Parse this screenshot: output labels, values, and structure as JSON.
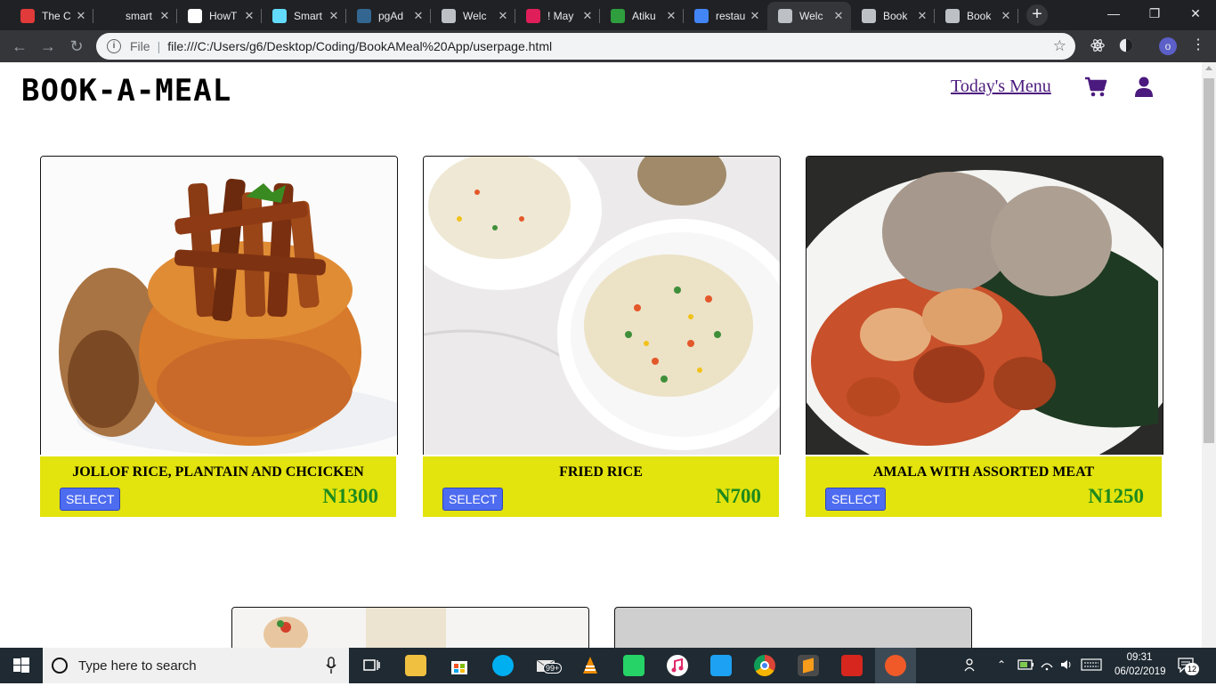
{
  "browser": {
    "tabs": [
      {
        "title": "The C",
        "favicon_color": "#e03a3a"
      },
      {
        "title": "smart",
        "favicon_color": "#202124"
      },
      {
        "title": "HowT",
        "favicon_color": "#ffffff"
      },
      {
        "title": "Smart",
        "favicon_color": "#61dafb"
      },
      {
        "title": "pgAd",
        "favicon_color": "#336791"
      },
      {
        "title": "Welc",
        "favicon_color": "#bdc1c6"
      },
      {
        "title": "! May",
        "favicon_color": "#e01e5a"
      },
      {
        "title": "Atiku",
        "favicon_color": "#2e9e3e"
      },
      {
        "title": "restau",
        "favicon_color": "#4285f4"
      },
      {
        "title": "Welc",
        "favicon_color": "#bdc1c6"
      },
      {
        "title": "Book",
        "favicon_color": "#bdc1c6"
      },
      {
        "title": "Book",
        "favicon_color": "#bdc1c6"
      }
    ],
    "active_tab_index": 9,
    "close_glyph": "✕",
    "new_tab_glyph": "+",
    "address": {
      "scheme_label": "File",
      "url": "file:///C:/Users/g6/Desktop/Coding/BookAMeal%20App/userpage.html"
    },
    "profile_initial": "o"
  },
  "page": {
    "logo": "BOOK-A-MEAL",
    "nav_link": "Today's Menu",
    "accent_color": "#4b1a7e",
    "meals": [
      {
        "name": "JOLLOF RICE, PLANTAIN AND CHCICKEN",
        "price": "N1300",
        "button": "SELECT"
      },
      {
        "name": "FRIED RICE",
        "price": "N700",
        "button": "SELECT"
      },
      {
        "name": "AMALA WITH ASSORTED MEAT",
        "price": "N1250",
        "button": "SELECT"
      }
    ],
    "caption_color": "#e3e30d",
    "price_color": "#1d8a1d",
    "button_color": "#4e6cf0"
  },
  "taskbar": {
    "search_placeholder": "Type here to search",
    "store_badge": "99+",
    "time": "09:31",
    "date": "06/02/2019",
    "notifications": "12"
  }
}
